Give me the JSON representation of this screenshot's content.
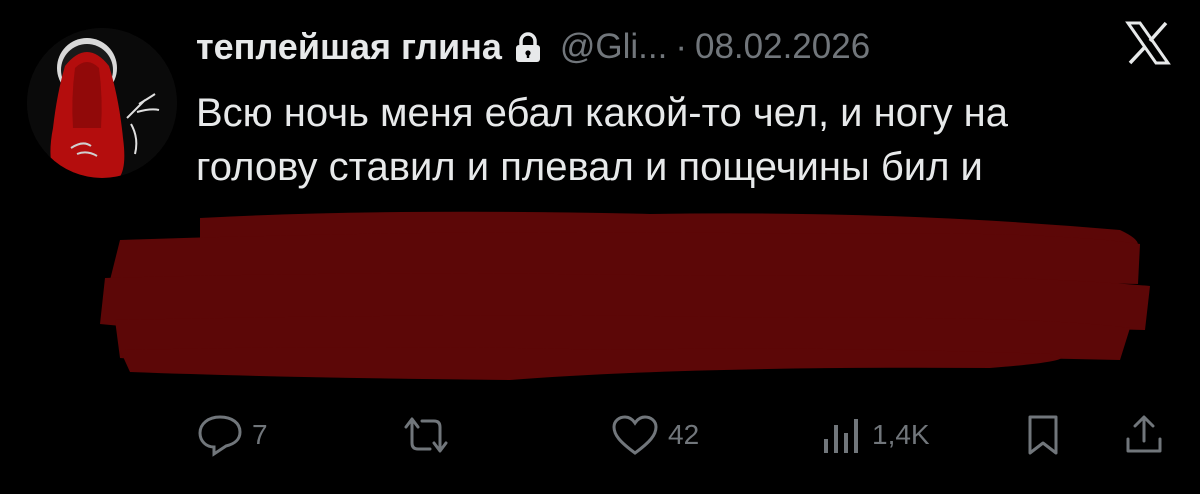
{
  "author": {
    "display_name": "теплейшая глина",
    "handle": "@Gli...",
    "date": "08.02.2026",
    "protected_icon": "lock-icon",
    "avatar_icon": "red-veiled-figure-avatar"
  },
  "tweet": {
    "lines": [
      "Всю ночь меня ебал какой-то чел, и ногу на",
      "голову ставил и плевал и пощечины бил и"
    ],
    "redaction_color": "#5c0707"
  },
  "actions": {
    "reply": {
      "icon": "reply-icon",
      "count": "7"
    },
    "repost": {
      "icon": "repost-icon",
      "count": ""
    },
    "like": {
      "icon": "heart-icon",
      "count": "42"
    },
    "views": {
      "icon": "views-icon",
      "count": "1,4K"
    },
    "bookmark": {
      "icon": "bookmark-icon"
    },
    "share": {
      "icon": "share-icon"
    }
  },
  "platform_icon": "x-logo-icon",
  "colors": {
    "background": "#000000",
    "text": "#e7e9ea",
    "muted": "#71767b"
  }
}
